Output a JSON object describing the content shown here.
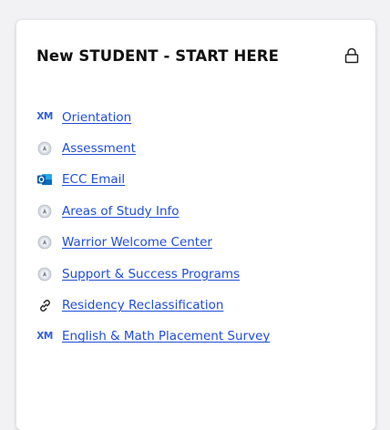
{
  "card": {
    "title": "New STUDENT - START HERE",
    "lock_icon": "lock-icon"
  },
  "links": [
    {
      "label": "Orientation",
      "icon": "xm-icon",
      "icon_text": "XM"
    },
    {
      "label": "Assessment",
      "icon": "app-launcher-icon"
    },
    {
      "label": "ECC Email",
      "icon": "outlook-icon"
    },
    {
      "label": "Areas of Study Info",
      "icon": "app-launcher-icon"
    },
    {
      "label": "Warrior Welcome Center",
      "icon": "app-launcher-icon"
    },
    {
      "label": "Support & Success Programs",
      "icon": "app-launcher-icon"
    },
    {
      "label": "Residency Reclassification",
      "icon": "link-icon"
    },
    {
      "label": "English & Math Placement Survey",
      "icon": "xm-icon",
      "icon_text": "XM"
    }
  ],
  "colors": {
    "link": "#1f4ed8",
    "title": "#111111",
    "xm": "#2f5fe0",
    "outlook": "#0f6cbd"
  }
}
